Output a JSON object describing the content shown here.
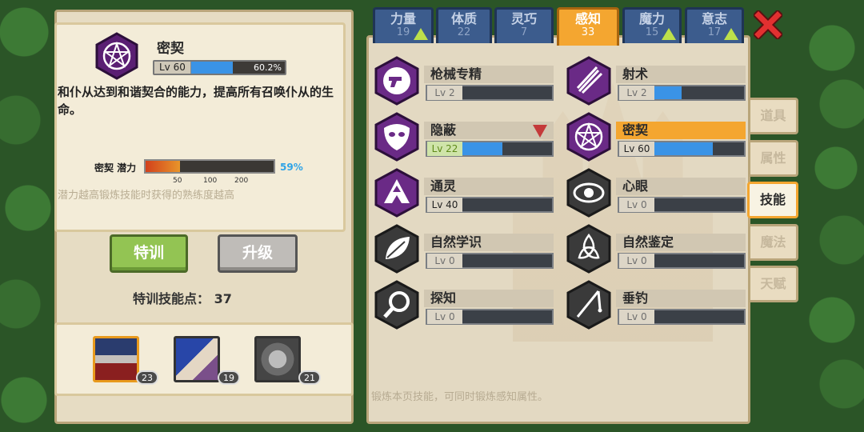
{
  "selected_skill": {
    "name": "密契",
    "level": "Lv 60",
    "progress_text": "60.2%",
    "progress": 0.602,
    "description": "和仆从达到和谐契合的能力，提高所有召唤仆从的生命。",
    "potential_label": "密契 潜力",
    "potential_pct": "59%",
    "potential_fraction": 0.27,
    "potential_ticks": [
      "50",
      "100",
      "200"
    ],
    "potential_hint": "潜力越高锻炼技能时获得的熟练度越高"
  },
  "buttons": {
    "train": "特训",
    "upgrade": "升级"
  },
  "training_points": "特训技能点：  37",
  "party": [
    {
      "name": "member-1",
      "level": "23",
      "selected": true
    },
    {
      "name": "member-2",
      "level": "19",
      "selected": false
    },
    {
      "name": "member-3",
      "level": "21",
      "selected": false
    }
  ],
  "attribute_tabs": [
    {
      "label": "力量",
      "value": "19",
      "upgradable": true,
      "active": false
    },
    {
      "label": "体质",
      "value": "22",
      "upgradable": false,
      "active": false
    },
    {
      "label": "灵巧",
      "value": "7",
      "upgradable": false,
      "active": false
    },
    {
      "label": "感知",
      "value": "33",
      "upgradable": false,
      "active": true
    },
    {
      "label": "魔力",
      "value": "15",
      "upgradable": true,
      "active": false
    },
    {
      "label": "意志",
      "value": "17",
      "upgradable": true,
      "active": false
    }
  ],
  "side_tabs": [
    "道具",
    "属性",
    "技能",
    "魔法",
    "天赋"
  ],
  "active_side_tab": "技能",
  "skills": [
    {
      "name": "枪械专精",
      "level": "Lv 2",
      "progress": 0.0,
      "icon": "pistol-icon"
    },
    {
      "name": "射术",
      "level": "Lv 2",
      "progress": 0.5,
      "icon": "arrows-icon"
    },
    {
      "name": "隐蔽",
      "level": "Lv 22",
      "progress": 0.6,
      "icon": "mask-icon",
      "level_color": "green",
      "marker": "down"
    },
    {
      "name": "密契",
      "level": "Lv 60",
      "progress": 0.75,
      "icon": "pentagram-icon",
      "selected": true
    },
    {
      "name": "通灵",
      "level": "Lv 40",
      "progress": 0.0,
      "icon": "triforce-icon"
    },
    {
      "name": "心眼",
      "level": "Lv 0",
      "progress": 0.0,
      "icon": "vortex-eye-icon"
    },
    {
      "name": "自然学识",
      "level": "Lv 0",
      "progress": 0.0,
      "icon": "leaf-icon"
    },
    {
      "name": "自然鉴定",
      "level": "Lv 0",
      "progress": 0.0,
      "icon": "triquetra-icon"
    },
    {
      "name": "探知",
      "level": "Lv 0",
      "progress": 0.0,
      "icon": "magnifier-icon"
    },
    {
      "name": "垂钓",
      "level": "Lv 0",
      "progress": 0.0,
      "icon": "fishing-rod-icon"
    }
  ],
  "footer_hint": "锻炼本页技能，可同时锻炼感知属性。",
  "colors": {
    "accent_orange": "#f4a630",
    "bar_blue": "#3a93e6",
    "tab_blue": "#3c5c8d",
    "skill_purple": "#6a2a86"
  }
}
